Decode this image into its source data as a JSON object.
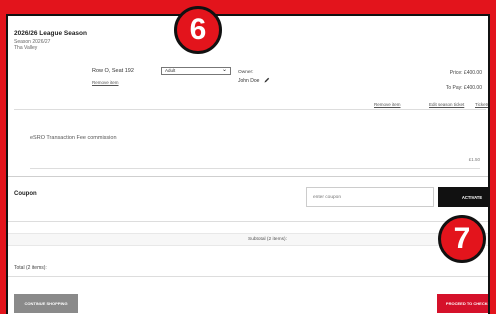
{
  "cart": {
    "season_title": "2026/26 League Season",
    "season_subtitle": "Season 2026/27",
    "venue": "Tha Valley",
    "seat_label": "Row O, Seat 192",
    "remove_item_link": "Remove item",
    "ticket_type": "Adult",
    "owner_label": "Owner:",
    "owner_name": "John Doe",
    "price_text": "Price: £400.00",
    "to_pay_text": "To Pay: £400.00",
    "actions": {
      "remove_item": "Remove item",
      "edit_season_ticket": "Edit season ticket",
      "tickets": "Tickets"
    },
    "fee_label": "eSRO Transaction Fee commission",
    "fee_amount": "£1.50",
    "coupon_label": "Coupon",
    "coupon_placeholder": "enter coupon",
    "activate_label": "ACTIVATE",
    "subtotal_label": "Subtotal (2 items):",
    "total_label": "Total (2 items):",
    "continue_label": "CONTINUE SHOPPING",
    "checkout_label": "PROCEED TO CHECKOUT"
  },
  "badges": {
    "first": "6",
    "second": "7"
  },
  "colors": {
    "background_red": "#e3141c",
    "checkout_red": "#d5112a",
    "continue_grey": "#8a8a8a",
    "activate_black": "#111111"
  },
  "icons": {
    "owner_edit": "pencil-icon",
    "ticket_type_toggle": "chevron-down-icon"
  }
}
